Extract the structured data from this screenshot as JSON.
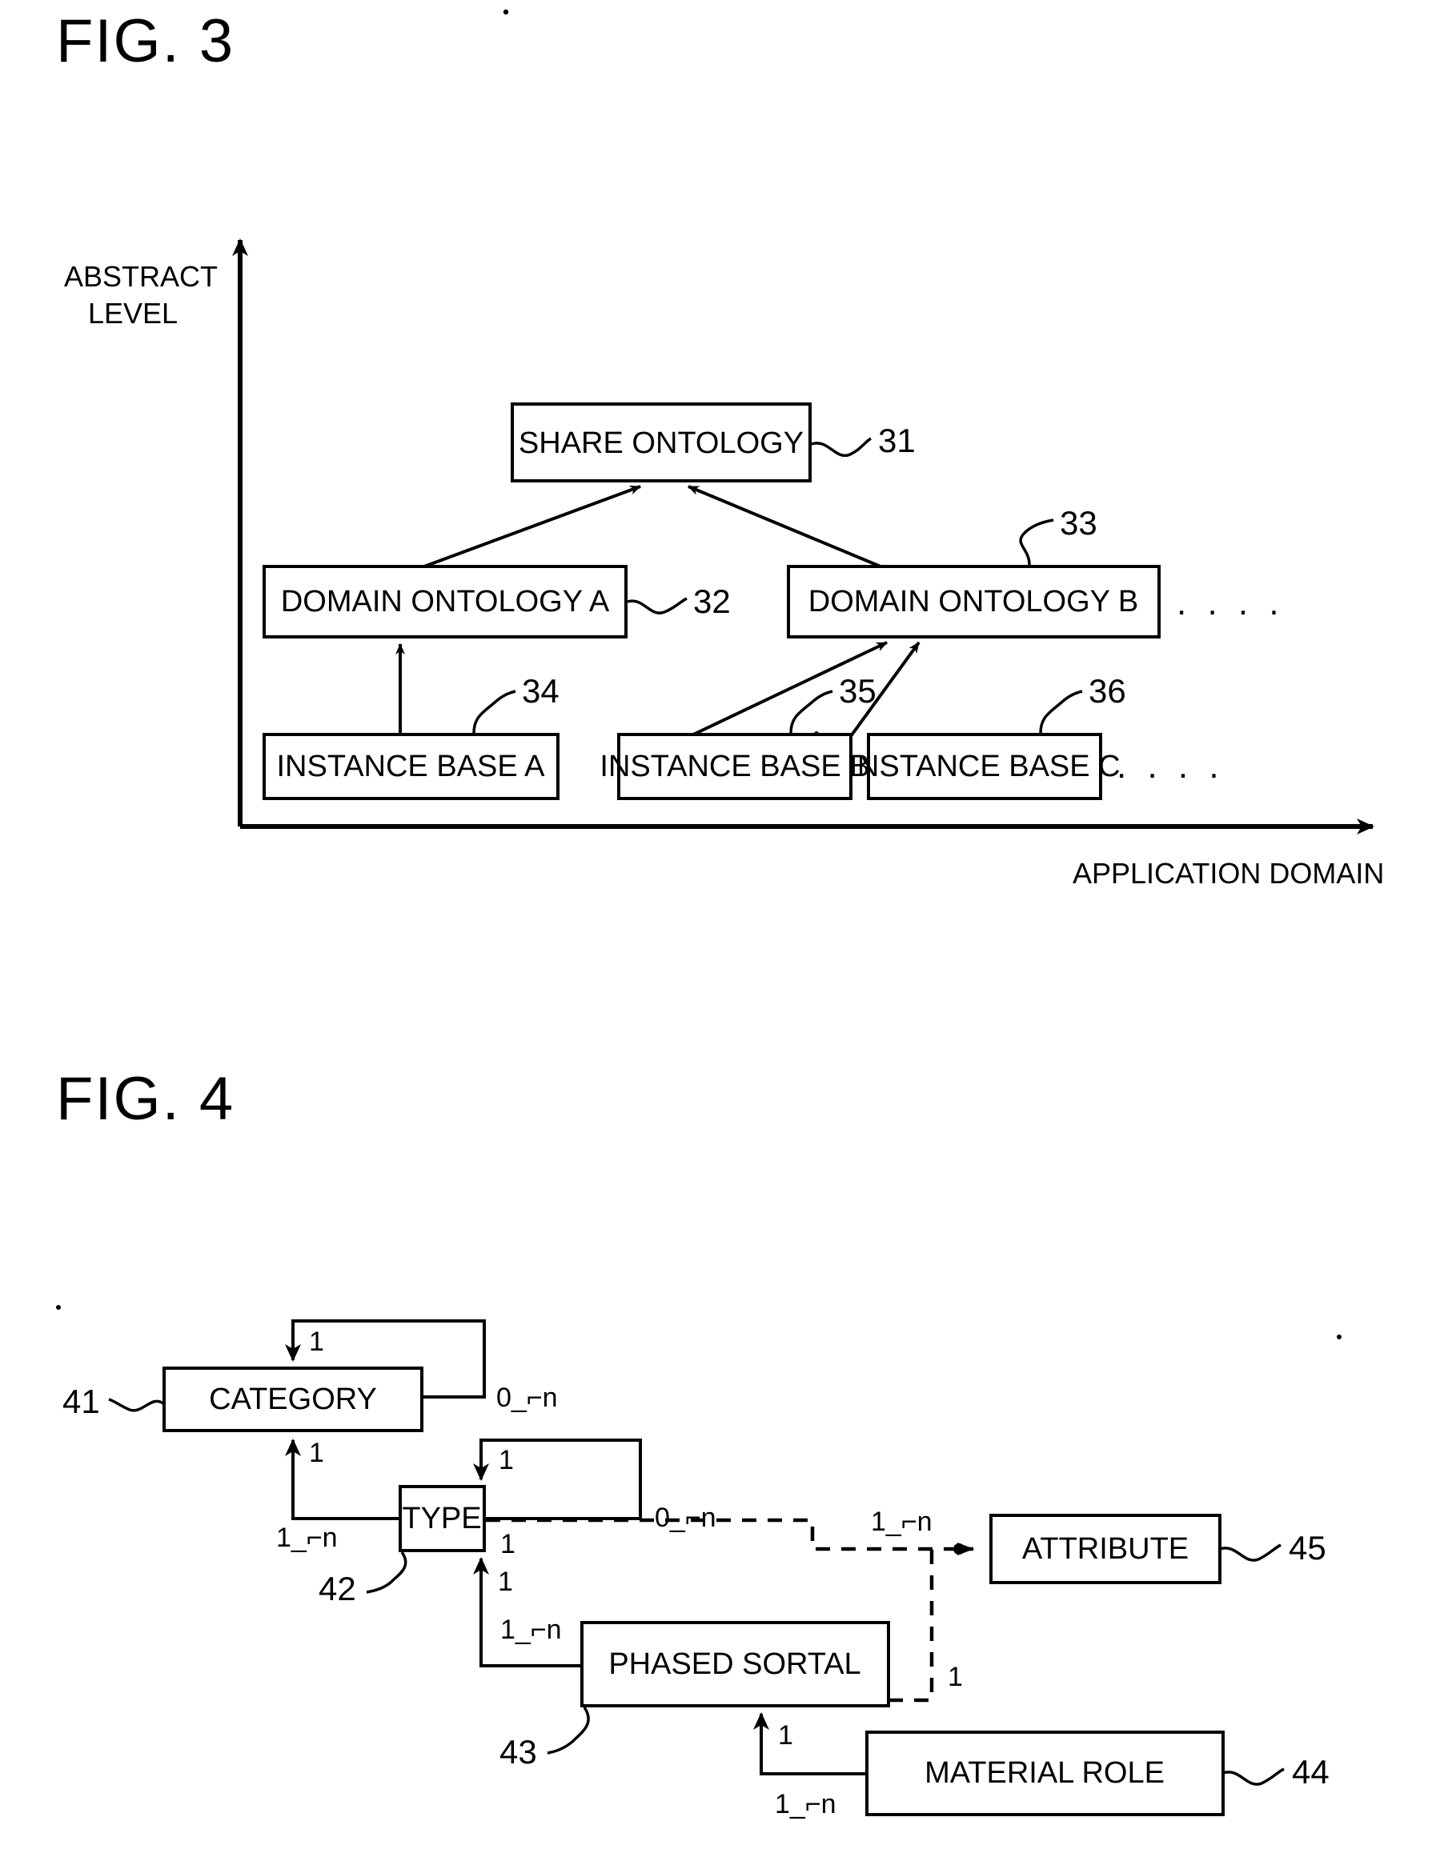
{
  "document": {
    "type": "patent-drawing-sheet",
    "figures": [
      "FIG. 3",
      "FIG. 4"
    ]
  },
  "fig3": {
    "title": "FIG. 3",
    "y_axis_label_line1": "ABSTRACT",
    "y_axis_label_line2": "LEVEL",
    "x_axis_label": "APPLICATION DOMAIN",
    "nodes": [
      {
        "id": "31",
        "label": "SHARE ONTOLOGY",
        "ref": "31"
      },
      {
        "id": "32",
        "label": "DOMAIN ONTOLOGY A",
        "ref": "32"
      },
      {
        "id": "33",
        "label": "DOMAIN ONTOLOGY B",
        "ref": "33"
      },
      {
        "id": "34",
        "label": "INSTANCE BASE A",
        "ref": "34"
      },
      {
        "id": "35",
        "label": "INSTANCE BASE B",
        "ref": "35"
      },
      {
        "id": "36",
        "label": "INSTANCE BASE C",
        "ref": "36"
      }
    ],
    "ellipsis_domain": ". . . .",
    "ellipsis_instance": ". . . .",
    "edges": [
      {
        "from": "32",
        "to": "31"
      },
      {
        "from": "33",
        "to": "31"
      },
      {
        "from": "34",
        "to": "32"
      },
      {
        "from": "35",
        "to": "33"
      },
      {
        "from": "36",
        "to": "33"
      }
    ]
  },
  "fig4": {
    "title": "FIG. 4",
    "nodes": [
      {
        "id": "41",
        "label": "CATEGORY",
        "ref": "41"
      },
      {
        "id": "42",
        "label": "TYPE",
        "ref": "42"
      },
      {
        "id": "43",
        "label": "PHASED SORTAL",
        "ref": "43"
      },
      {
        "id": "44",
        "label": "MATERIAL ROLE",
        "ref": "44"
      },
      {
        "id": "45",
        "label": "ATTRIBUTE",
        "ref": "45"
      }
    ],
    "cardinalities": {
      "category_self_one": "1",
      "category_self_many": "0_⌐n",
      "category_from_type_one": "1",
      "type_to_category_many": "1_⌐n",
      "type_self_one": "1",
      "type_self_many": "0_⌐n",
      "type_attribute_one": "1",
      "attribute_many": "1_⌐n",
      "type_from_sortal_one": "1",
      "sortal_to_type_many": "1_⌐n",
      "sortal_attribute_one": "1",
      "sortal_from_role_one": "1",
      "role_to_sortal_many": "1_⌐n"
    },
    "edges": [
      {
        "from": "41",
        "to": "41",
        "style": "solid",
        "note": "self reference"
      },
      {
        "from": "42",
        "to": "41",
        "style": "solid"
      },
      {
        "from": "42",
        "to": "42",
        "style": "solid",
        "note": "self reference"
      },
      {
        "from": "42",
        "to": "45",
        "style": "dashed"
      },
      {
        "from": "43",
        "to": "42",
        "style": "solid"
      },
      {
        "from": "43",
        "to": "45",
        "style": "dashed"
      },
      {
        "from": "44",
        "to": "43",
        "style": "solid"
      }
    ]
  },
  "colors": {
    "ink": "#000000",
    "paper": "#ffffff"
  }
}
